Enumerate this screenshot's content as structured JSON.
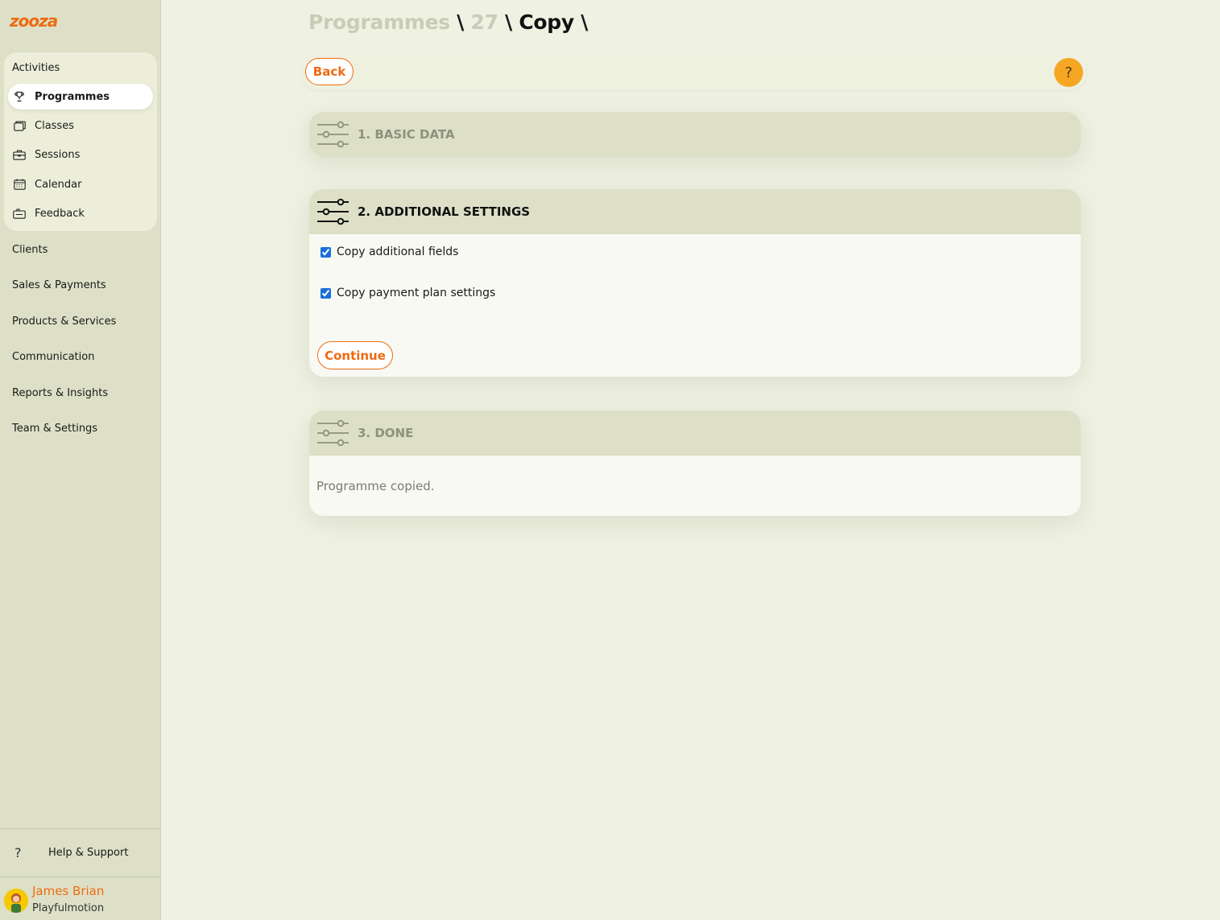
{
  "sidebar": {
    "logo_text": "zooza",
    "activities": {
      "title": "Activities",
      "items": [
        {
          "label": "Programmes",
          "icon": "trophy-icon",
          "active": true
        },
        {
          "label": "Classes",
          "icon": "folder-icon",
          "active": false
        },
        {
          "label": "Sessions",
          "icon": "briefcase-icon",
          "active": false
        },
        {
          "label": "Calendar",
          "icon": "calendar-icon",
          "active": false
        },
        {
          "label": "Feedback",
          "icon": "feedback-icon",
          "active": false
        }
      ]
    },
    "nav": [
      {
        "label": "Clients"
      },
      {
        "label": "Sales & Payments"
      },
      {
        "label": "Products & Services"
      },
      {
        "label": "Communication"
      },
      {
        "label": "Reports & Insights"
      },
      {
        "label": "Team & Settings"
      }
    ],
    "help": {
      "icon": "?",
      "label": "Help & Support"
    },
    "user": {
      "name": "James Brian",
      "org": "Playfulmotion"
    }
  },
  "breadcrumb": {
    "part1": "Programmes",
    "sep1": " \\ ",
    "part2": "27",
    "sep2": " \\ ",
    "current": "Copy",
    "sep3": " \\"
  },
  "toolbar": {
    "back_label": "Back",
    "help_label": "?"
  },
  "steps": [
    {
      "title": "1. BASIC DATA"
    },
    {
      "title": "2. ADDITIONAL SETTINGS",
      "options": [
        {
          "label": "Copy additional fields",
          "checked": true
        },
        {
          "label": "Copy payment plan settings",
          "checked": true
        }
      ],
      "continue_label": "Continue"
    },
    {
      "title": "3. DONE",
      "message": "Programme copied."
    }
  ],
  "colors": {
    "accent": "#ef6a12",
    "help_button": "#f5a623",
    "sidebar_bg": "#dde0c6",
    "page_bg": "#eff2e3"
  }
}
